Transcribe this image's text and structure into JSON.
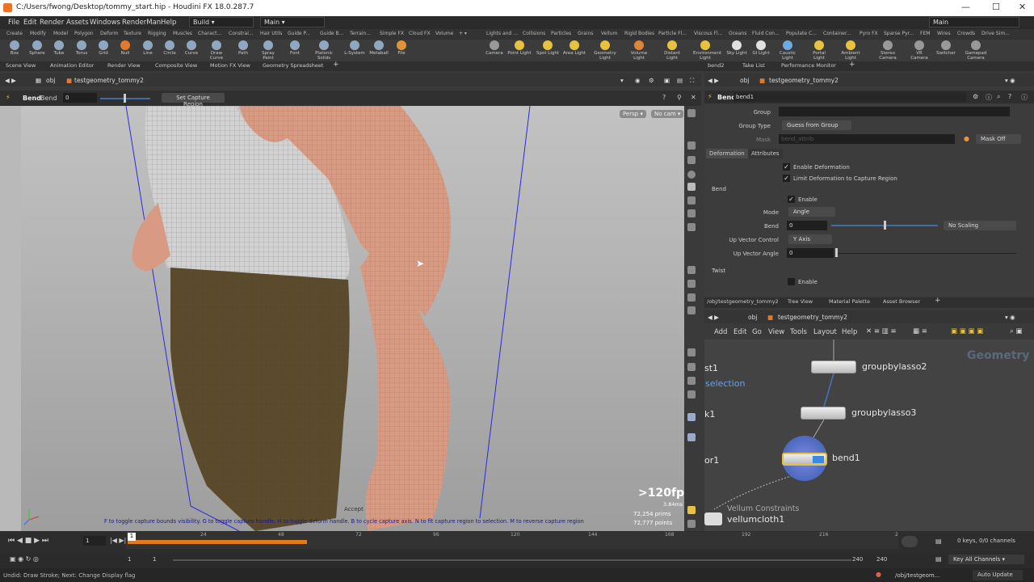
{
  "titlebar": {
    "title": "C:/Users/fwong/Desktop/tommy_start.hip - Houdini FX 18.0.287.7",
    "minimize": "—",
    "maximize": "☐",
    "close": "✕"
  },
  "menubar": {
    "items": [
      "File",
      "Edit",
      "Render",
      "Assets",
      "Windows",
      "RenderMan",
      "Help"
    ],
    "desktop": "Build",
    "main": "Main",
    "right_main": "Main"
  },
  "shelf_tabs_left": [
    "Create",
    "Modify",
    "Model",
    "Polygon",
    "Deform",
    "Texture",
    "Rigging",
    "Muscles",
    "Charact...",
    "Constrai...",
    "Hair Utils",
    "Guide P...",
    "Guide B...",
    "Terrain...",
    "Simple FX",
    "Cloud FX",
    "Volume"
  ],
  "shelf_tabs_right": [
    "Lights and ...",
    "Collisions",
    "Particles",
    "Grains",
    "Vellum",
    "Rigid Bodies",
    "Particle Fl...",
    "Viscous Fl...",
    "Oceans",
    "Fluid Con...",
    "Populate C...",
    "Container...",
    "Pyro FX",
    "Sparse Pyr...",
    "FEM",
    "Wires",
    "Crowds",
    "Drive Sim..."
  ],
  "tools_left": [
    "Box",
    "Sphere",
    "Tube",
    "Torus",
    "Grid",
    "Null",
    "Line",
    "Circle",
    "Curve",
    "Draw Curve",
    "Path",
    "Spray Paint",
    "Font",
    "Platonic Solids",
    "L-System",
    "Metaball",
    "File"
  ],
  "tools_right": [
    "Camera",
    "Point Light",
    "Spot Light",
    "Area Light",
    "Geometry Light",
    "Volume Light",
    "Distant Light",
    "Environment Light",
    "Sky Light",
    "GI Light",
    "Caustic Light",
    "Portal Light",
    "Ambient Light",
    "Stereo Camera",
    "VR Camera",
    "Switcher",
    "Gamepad Camera"
  ],
  "pane_tabs_left": [
    "Scene View",
    "Animation Editor",
    "Render View",
    "Composite View",
    "Motion FX View",
    "Geometry Spreadsheet"
  ],
  "pane_tabs_right": [
    "bend2",
    "Take List",
    "Performance Monitor"
  ],
  "left_path": {
    "root": "obj",
    "node": "testgeometry_tommy2"
  },
  "opbar": {
    "op": "Bend",
    "label": "Bend",
    "value": "0",
    "button": "Set Capture Region"
  },
  "viewport": {
    "persp": "Persp",
    "cam": "No cam",
    "fps": ">120fps",
    "ms": "3.84ms",
    "prims_val": "72,254",
    "prims": "prims",
    "points_val": "72,777",
    "points": "points",
    "accept": "Accept",
    "hint": "F to toggle capture bounds visibility. G to toggle capture handle. H to toggle deform handle. B to cycle capture axis. N to fit capture region to selection. M to reverse capture region"
  },
  "params": {
    "path_root": "obj",
    "path_node": "testgeometry_tommy2",
    "op": "Bend",
    "name": "bend1",
    "group_label": "Group",
    "group_type_label": "Group Type",
    "group_type": "Guess from Group",
    "mask_label": "Mask",
    "mask_placeholder": "bend_attrib",
    "mask_off": "Mask Off",
    "tabs": [
      "Deformation",
      "Attributes"
    ],
    "enable_deformation": "Enable Deformation",
    "limit_deformation": "Limit Deformation to Capture Region",
    "bend_section": "Bend",
    "enable": "Enable",
    "mode_label": "Mode",
    "mode": "Angle",
    "bend_label": "Bend",
    "bend_value": "0",
    "scaling": "No Scaling",
    "upvec_label": "Up Vector Control",
    "upvec": "Y Axis",
    "upangle_label": "Up Vector Angle",
    "upangle_value": "0",
    "twist_section": "Twist",
    "twist_enable": "Enable"
  },
  "net_tabs": [
    "/obj/testgeometry_tommy2",
    "Tree View",
    "Material Palette",
    "Asset Browser"
  ],
  "net_path": {
    "root": "obj",
    "node": "testgeometry_tommy2"
  },
  "net_menu": [
    "Add",
    "Edit",
    "Go",
    "View",
    "Tools",
    "Layout",
    "Help"
  ],
  "network": {
    "context": "Geometry",
    "left_labels": [
      "st1",
      "selection",
      "k1",
      "or1"
    ],
    "nodes": [
      "groupbylasso2",
      "groupbylasso3",
      "bend1"
    ],
    "vellum_title": "Vellum Constraints",
    "vellum_node": "vellumcloth1"
  },
  "timeline": {
    "frame": "1",
    "ticks": [
      "24",
      "48",
      "72",
      "96",
      "120",
      "144",
      "168",
      "192",
      "216",
      "2"
    ],
    "keys": "0 keys, 0/0 channels",
    "key_all": "Key All Channels",
    "range_start": "1",
    "range_start2": "1",
    "range_end": "240",
    "range_end2": "240"
  },
  "status": {
    "left": "Undid: Draw Stroke; Next: Change Display flag",
    "path": "/obj/testgeom...",
    "update": "Auto Update"
  }
}
